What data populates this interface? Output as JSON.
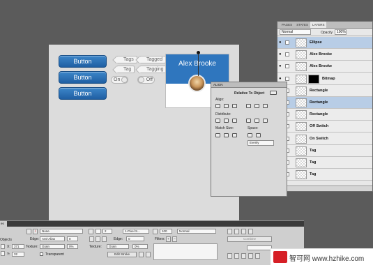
{
  "canvas": {
    "buttons": [
      "Button",
      "Button",
      "Button"
    ],
    "tags": [
      "Tags",
      "Tagged",
      "Tag",
      "Tagging"
    ],
    "switches": {
      "on": "On",
      "off": "Off"
    },
    "profile_name": "Alex Brooke"
  },
  "layers_panel": {
    "tabs": [
      "PAGES",
      "STATES",
      "LAYERS"
    ],
    "blend_mode": "Normal",
    "opacity_label": "Opacity",
    "opacity": "100%",
    "layers": [
      {
        "name": "Ellipse",
        "selected": true
      },
      {
        "name": "Alex Brooke",
        "selected": false
      },
      {
        "name": "Alex Brooke",
        "selected": false
      },
      {
        "name": "Bitmap",
        "selected": false
      },
      {
        "name": "Rectangle",
        "selected": false
      },
      {
        "name": "Rectangle",
        "selected": true
      },
      {
        "name": "Rectangle",
        "selected": false
      },
      {
        "name": "Off Switch",
        "selected": false
      },
      {
        "name": "On Switch",
        "selected": false
      },
      {
        "name": "Tag",
        "selected": false
      },
      {
        "name": "Tag",
        "selected": false
      },
      {
        "name": "Tag",
        "selected": false
      }
    ]
  },
  "align_panel": {
    "title": "ALIGN",
    "relative_label": "Relative To Object",
    "align_label": "Align:",
    "distribute_label": "Distribute:",
    "match_size_label": "Match Size:",
    "space_label": "Space:",
    "space_value": "Evenly"
  },
  "properties": {
    "tab": "es",
    "objects_label": "Objects",
    "fill_none": "None",
    "edge_label": "Edge:",
    "edge_value": "Anti-Alias",
    "edge_num": "0",
    "texture_label": "Texture:",
    "texture_value": "Grain",
    "texture_pct": "0%",
    "transparent_label": "Transparent",
    "x_label": "X:",
    "x_value": "371",
    "y_label": "Y:",
    "y_value": "32",
    "stroke_size": "2",
    "stroke_type": "1-Pixel S...",
    "edge2_label": "Edge:",
    "edge2_value": "0",
    "texture2_label": "Texture:",
    "texture2_value": "Grain",
    "texture2_pct": "0%",
    "edit_stroke": "Edit Stroke",
    "opacity_value": "100",
    "blend": "Normal",
    "filters_label": "Filters",
    "combine_label": "Combine"
  },
  "watermark": {
    "text": "智可网 www.hzhike.com",
    "brand_color": "#d61f26"
  }
}
